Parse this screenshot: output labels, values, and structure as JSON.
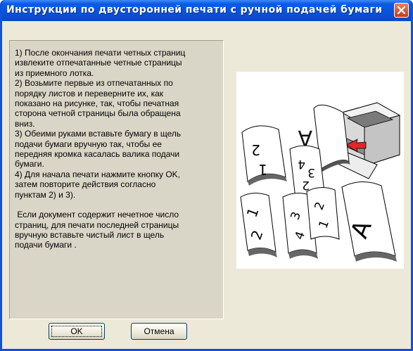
{
  "window": {
    "title": "Инструкции по двусторонней печати с ручной подачей бумаги"
  },
  "instructions": {
    "step1": "1) После окончания печати четных страниц\nизвлеките отпечатанные четные страницы\nиз приемного лотка.",
    "step2": "2) Возьмите первые из отпечатанных по\nпорядку листов и переверните их, как\nпоказано на рисунке, так, чтобы печатная\nсторона четной страницы была обращена\nвниз.",
    "step3": "3) Обеими руками вставьте бумагу в щель\nподачи бумаги вручную так, чтобы ее\nпередняя кромка касалась валика подачи\nбумаги.",
    "step4": "4) Для начала печати нажмите кнопку OK,\nзатем повторите действия согласно\nпунктам 2) и 3).",
    "note": " Если документ содержит нечетное число\nстраниц, для печати последней страницы\nвручную вставьте чистый лист в щель\nподачи бумаги ."
  },
  "illustration": {
    "page_numbers": [
      "2",
      "1",
      "4",
      "3",
      "2",
      "1",
      "1",
      "2",
      "3",
      "4",
      "2",
      "1"
    ],
    "paper_letter": "A",
    "icon": "printer-duplex-illustration"
  },
  "buttons": {
    "ok_label": "OK",
    "cancel_label": "Отмена"
  },
  "colors": {
    "title_bar": "#0a53de",
    "close_button": "#d4522a",
    "dialog_bg": "#ece9d8",
    "text_panel_bg": "#dad6c7",
    "arrow_red": "#e3242b"
  }
}
